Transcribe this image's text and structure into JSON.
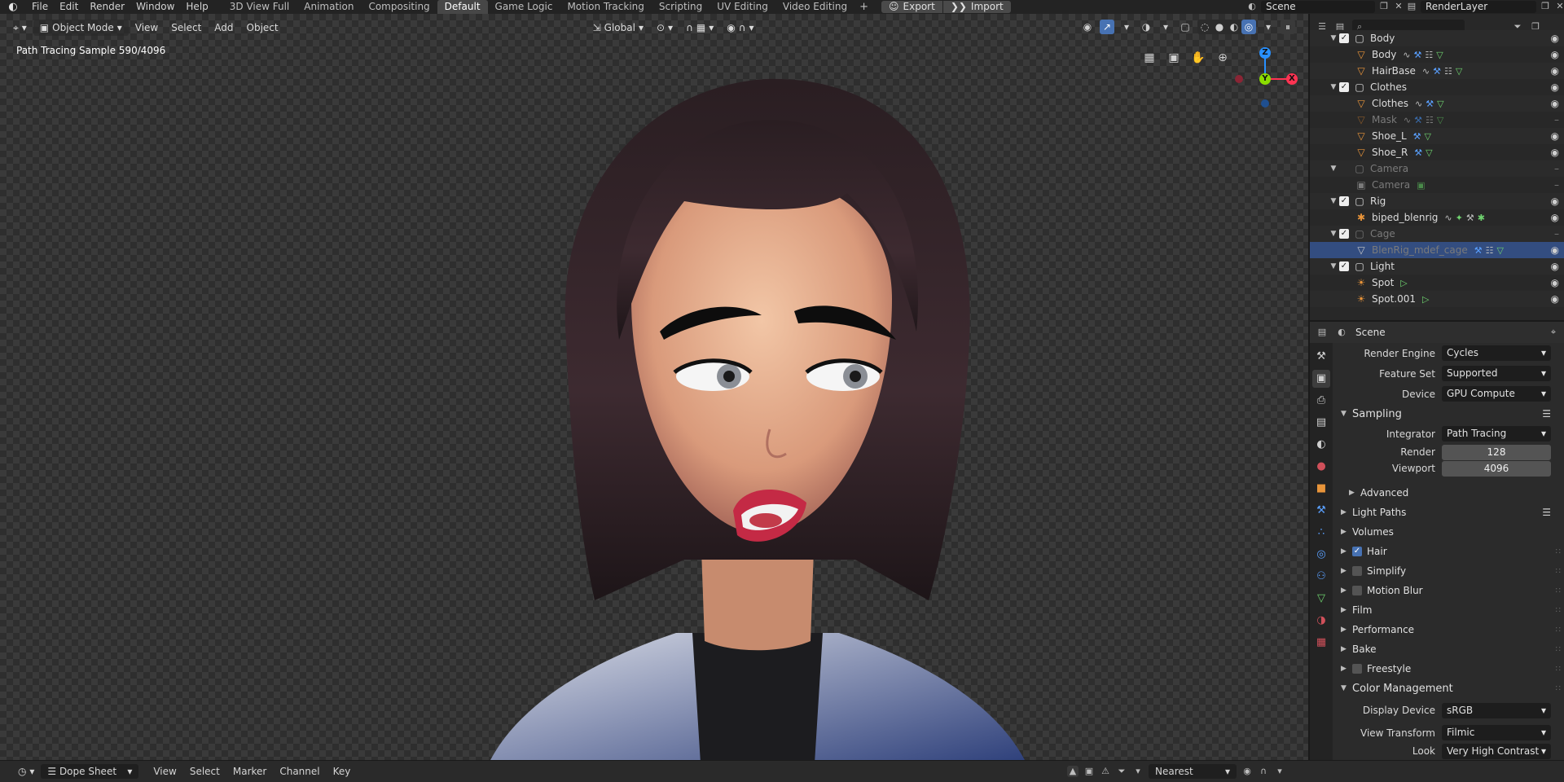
{
  "topbar": {
    "menus": [
      "File",
      "Edit",
      "Render",
      "Window",
      "Help"
    ],
    "workspaces": [
      "3D View Full",
      "Animation",
      "Compositing",
      "Default",
      "Game Logic",
      "Motion Tracking",
      "Scripting",
      "UV Editing",
      "Video Editing"
    ],
    "active_workspace": "Default",
    "add_tab": "+",
    "export_label": "Export",
    "import_label": "Import",
    "scene_name": "Scene",
    "view_layer": "RenderLayer"
  },
  "viewport": {
    "mode": "Object Mode",
    "menus": [
      "View",
      "Select",
      "Add",
      "Object"
    ],
    "transform_orientation": "Global",
    "status_text": "Path Tracing Sample 590/4096",
    "gizmo_axes": {
      "z": "Z",
      "y": "Y",
      "x": "X"
    },
    "colors": {
      "x_axis": "#ff3352",
      "y_axis": "#8bdc00",
      "z_axis": "#2890ff",
      "active": "#4772b3"
    }
  },
  "outliner": {
    "search_placeholder": "",
    "rows": [
      {
        "label": "Body",
        "kind": "collection",
        "checked": true
      },
      {
        "label": "Body",
        "kind": "mesh"
      },
      {
        "label": "HairBase",
        "kind": "mesh"
      },
      {
        "label": "Clothes",
        "kind": "collection",
        "checked": true
      },
      {
        "label": "Clothes",
        "kind": "mesh"
      },
      {
        "label": "Mask",
        "kind": "mesh",
        "dim": true
      },
      {
        "label": "Shoe_L",
        "kind": "mesh"
      },
      {
        "label": "Shoe_R",
        "kind": "mesh"
      },
      {
        "label": "Camera",
        "kind": "collection",
        "dim": true
      },
      {
        "label": "Camera",
        "kind": "camera",
        "dim": true
      },
      {
        "label": "Rig",
        "kind": "collection",
        "checked": true
      },
      {
        "label": "biped_blenrig",
        "kind": "armature"
      },
      {
        "label": "Cage",
        "kind": "collection",
        "dim": true,
        "checked": true
      },
      {
        "label": "BlenRig_mdef_cage",
        "kind": "mesh",
        "selected": true,
        "dim": true
      },
      {
        "label": "Light",
        "kind": "collection",
        "checked": true
      },
      {
        "label": "Spot",
        "kind": "light"
      },
      {
        "label": "Spot.001",
        "kind": "light"
      }
    ]
  },
  "properties": {
    "context": "Scene",
    "render_engine": {
      "label": "Render Engine",
      "value": "Cycles"
    },
    "feature_set": {
      "label": "Feature Set",
      "value": "Supported"
    },
    "device": {
      "label": "Device",
      "value": "GPU Compute"
    },
    "sampling": {
      "title": "Sampling",
      "integrator": {
        "label": "Integrator",
        "value": "Path Tracing"
      },
      "render": {
        "label": "Render",
        "value": "128"
      },
      "viewport": {
        "label": "Viewport",
        "value": "4096"
      },
      "advanced": "Advanced"
    },
    "panels": [
      {
        "label": "Light Paths",
        "checkbox": false,
        "list": true
      },
      {
        "label": "Volumes"
      },
      {
        "label": "Hair",
        "checkbox": true,
        "checked": true
      },
      {
        "label": "Simplify",
        "checkbox": true,
        "checked": false
      },
      {
        "label": "Motion Blur",
        "checkbox": true,
        "checked": false
      },
      {
        "label": "Film"
      },
      {
        "label": "Performance"
      },
      {
        "label": "Bake"
      },
      {
        "label": "Freestyle",
        "checkbox": true,
        "checked": false
      }
    ],
    "color_management": {
      "title": "Color Management",
      "display_device": {
        "label": "Display Device",
        "value": "sRGB"
      },
      "view_transform": {
        "label": "View Transform",
        "value": "Filmic"
      },
      "look": {
        "label": "Look",
        "value": "Very High Contrast"
      }
    }
  },
  "dopesheet": {
    "editor": "Dope Sheet",
    "menus": [
      "View",
      "Select",
      "Marker",
      "Channel",
      "Key"
    ],
    "snap": "Nearest Frame"
  }
}
